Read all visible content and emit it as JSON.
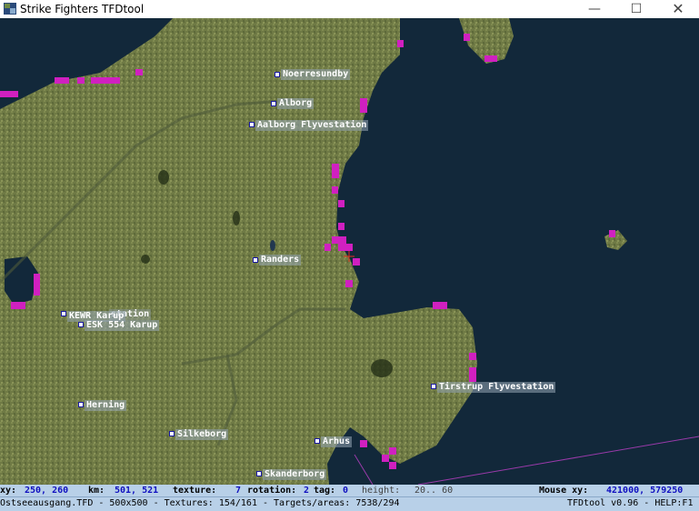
{
  "window": {
    "title": "Strike Fighters TFDtool",
    "minimize": "—",
    "maximize": "☐",
    "close": "✕"
  },
  "cities": [
    {
      "name": "Noerresundby"
    },
    {
      "name": "Alborg"
    },
    {
      "name": "Aalborg Flyvestation"
    },
    {
      "name": "Randers"
    },
    {
      "name": "KEWR Karup"
    },
    {
      "name": "station"
    },
    {
      "name": "ESK 554 Karup"
    },
    {
      "name": "Herning"
    },
    {
      "name": "Tirstrup Flyvestation"
    },
    {
      "name": "Silkeborg"
    },
    {
      "name": "Arhus"
    },
    {
      "name": "Skanderborg"
    }
  ],
  "status": {
    "xy_label": "xy:",
    "xy_value": "250, 260",
    "km_label": "km:",
    "km_value": "501, 521",
    "texture_label": "texture:",
    "texture_value": "7",
    "rotation_label": "rotation:",
    "rotation_value": "2",
    "tag_label": "tag:",
    "tag_value": "0",
    "height_label": "height:",
    "height_value": "20.. 60",
    "mouse_label": "Mouse xy:",
    "mouse_value": "421000, 579250"
  },
  "footer": {
    "info": "Ostseeausgang.TFD - 500x500 - Textures: 154/161 - Targets/areas: 7538/294",
    "version": "TFDtool v0.96 - HELP:F1"
  },
  "colors": {
    "water": "#12283a",
    "land": "#6f7a45",
    "marker": "#d020c0",
    "status_bg": "#b8d0e8"
  }
}
